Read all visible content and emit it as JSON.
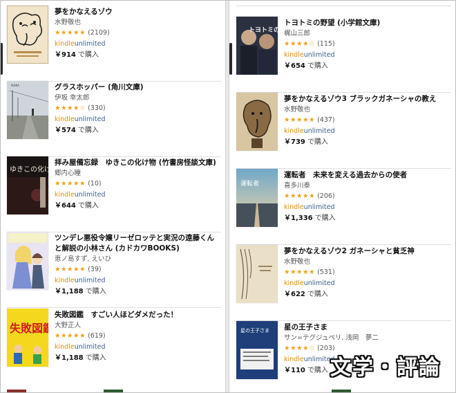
{
  "left_column": [
    {
      "title": "夢をかなえるゾウ",
      "author": "水野敬也",
      "stars": "★★★★★",
      "count": "(2109)",
      "ku_k": "kindle",
      "ku_u": "unlimited",
      "price": "￥914",
      "buy": "で購入",
      "cover_icon": "elephant-drawing-cover"
    },
    {
      "title": "グラスホッパー (角川文庫)",
      "author": "伊坂 幸太郎",
      "stars": "★★★★☆",
      "count": "(330)",
      "ku_k": "kindle",
      "ku_u": "unlimited",
      "price": "￥574",
      "buy": "で購入",
      "cover_icon": "rural-road-photo-cover"
    },
    {
      "title": "拝み屋備忘録　ゆきこの化け物 (竹書房怪談文庫)",
      "author": "郷内心瞳",
      "stars": "★★★★★",
      "count": "(10)",
      "ku_k": "kindle",
      "ku_u": "unlimited",
      "price": "￥644",
      "buy": "で購入",
      "cover_icon": "dark-horror-cover",
      "cover_text": "ゆきこの化け物"
    },
    {
      "title": "ツンデレ悪役令嬢リーゼロッテと実況の遠藤くんと解説の小林さん (カドカワBOOKS)",
      "author": "恵ノ島すず, えいひ",
      "stars": "★★★★★",
      "count": "(39)",
      "ku_k": "kindle",
      "ku_u": "unlimited",
      "price": "￥1,188",
      "buy": "で購入",
      "cover_icon": "anime-illustration-cover"
    },
    {
      "title": "失敗図鑑　すごい人ほどダメだった！",
      "author": "大野正人",
      "stars": "★★★★★",
      "count": "(619)",
      "ku_k": "kindle",
      "ku_u": "unlimited",
      "price": "￥1,188",
      "buy": "で購入",
      "cover_icon": "yellow-zukan-cover",
      "cover_text": "失敗図鑑"
    }
  ],
  "right_column": [
    {
      "title": "トヨトミの野望 (小学館文庫)",
      "author": "梶山三郎",
      "stars": "★★★★☆",
      "count": "(115)",
      "ku_k": "kindle",
      "ku_u": "unlimited",
      "price": "￥654",
      "buy": "で購入",
      "cover_icon": "two-portraits-cover",
      "cover_text": "トヨトミの野望"
    },
    {
      "title": "夢をかなえるゾウ3 ブラックガネーシャの教え",
      "author": "水野敬也",
      "stars": "★★★★★",
      "count": "(437)",
      "ku_k": "kindle",
      "ku_u": "unlimited",
      "price": "￥739",
      "buy": "で購入",
      "cover_icon": "elephant-figure-cover"
    },
    {
      "title": "運転者　未来を変える過去からの使者",
      "author": "喜多川泰",
      "stars": "★★★★★",
      "count": "(206)",
      "ku_k": "kindle",
      "ku_u": "unlimited",
      "price": "￥1,336",
      "buy": "で購入",
      "cover_icon": "railroad-dusk-cover",
      "cover_text": "運転者"
    },
    {
      "title": "夢をかなえるゾウ2 ガネーシャと貧乏神",
      "author": "水野敬也",
      "stars": "★★★★★",
      "count": "(531)",
      "ku_k": "kindle",
      "ku_u": "unlimited",
      "price": "￥622",
      "buy": "で購入",
      "cover_icon": "curtain-sketch-cover"
    },
    {
      "title": "星の王子さま",
      "author": "サン=テグジュペリ, 浅岡　夢二",
      "stars": "★★★★☆",
      "count": "(203)",
      "ku_k": "kindle",
      "ku_u": "unlimited",
      "price": "￥110",
      "buy": "で購入",
      "cover_icon": "little-prince-cover",
      "cover_text": "星の王子さま"
    }
  ],
  "overlay_label": "文学・評論",
  "colors": {
    "star": "#f0a11a",
    "kindle": "#e08f00",
    "unlimited": "#3a5f8a",
    "background": "#ffffff"
  }
}
